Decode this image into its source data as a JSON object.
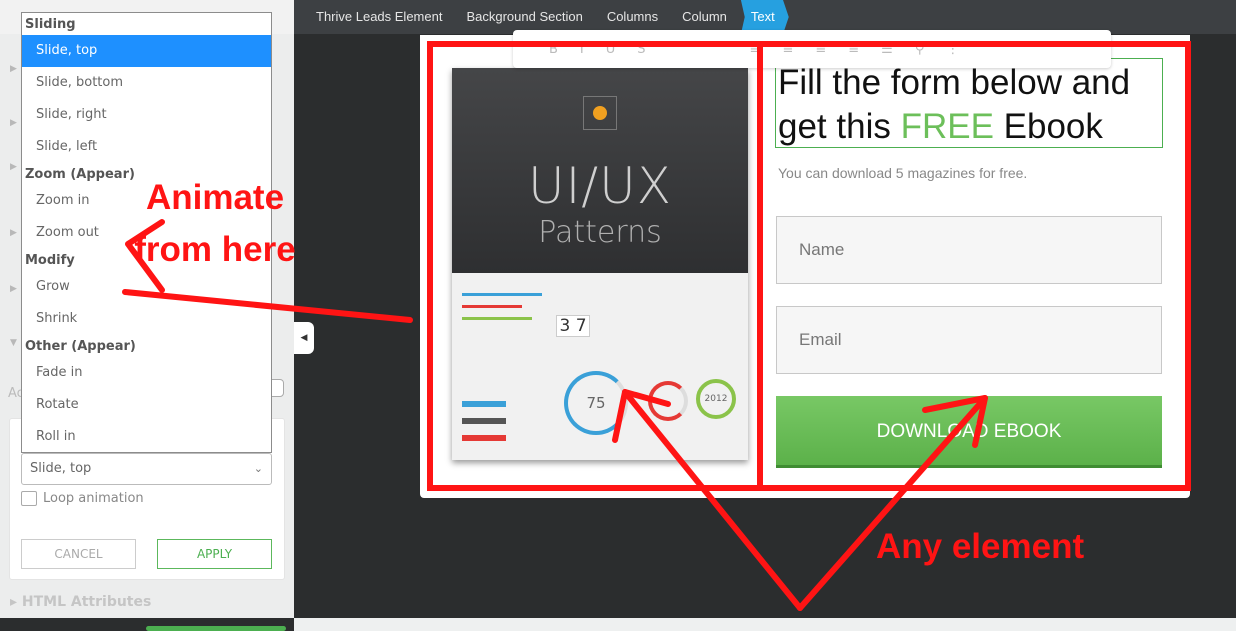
{
  "breadcrumb": [
    "Thrive Leads Element",
    "Background Section",
    "Columns",
    "Column",
    "Text"
  ],
  "animation_dropdown": {
    "groups": [
      {
        "label": "Sliding",
        "options": [
          "Slide, top",
          "Slide, bottom",
          "Slide, right",
          "Slide, left"
        ]
      },
      {
        "label": "Zoom (Appear)",
        "options": [
          "Zoom in",
          "Zoom out"
        ]
      },
      {
        "label": "Modify",
        "options": [
          "Grow",
          "Shrink"
        ]
      },
      {
        "label": "Other (Appear)",
        "options": [
          "Fade in",
          "Rotate",
          "Roll in"
        ]
      }
    ],
    "highlighted": "Slide, top",
    "selected_value": "Slide, top"
  },
  "panel": {
    "loop_label": "Loop animation",
    "loop_checked": false,
    "cancel": "CANCEL",
    "apply": "APPLY",
    "html_attributes": "HTML Attributes",
    "partial_label": "Ac"
  },
  "form": {
    "headline_pre": "Fill the form below and get this ",
    "headline_free": "FREE",
    "headline_post": " Ebook",
    "subtext": "You can download 5 magazines for free.",
    "name_placeholder": "Name",
    "email_placeholder": "Email",
    "button": "DOWNLOAD EBOOK"
  },
  "book": {
    "title": "UI/UX",
    "subtitle": "Patterns",
    "dial1": "75",
    "dial2": "2012",
    "counter": "3 7"
  },
  "annotations": {
    "left": "Animate from here",
    "right": "Any element"
  },
  "colors": {
    "highlight": "#1e90ff",
    "annotation": "#ff1414",
    "accent_green": "#5cb14a",
    "breadcrumb_active": "#26a0e0"
  }
}
